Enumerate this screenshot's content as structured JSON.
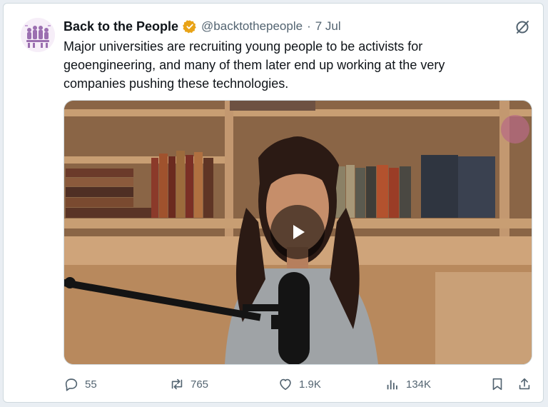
{
  "tweet": {
    "author_name": "Back to the People",
    "handle": "@backtothepeople",
    "separator": "·",
    "date": "7 Jul",
    "text": "Major universities are recruiting young people to be activists for geoengineering, and many of them later end up working at the very companies pushing these technologies."
  },
  "media": {
    "type": "video",
    "play_icon": "play-icon"
  },
  "actions": {
    "replies": "55",
    "reposts": "765",
    "likes": "1.9K",
    "views": "134K"
  },
  "colors": {
    "verified_badge": "#e8a317",
    "secondary_text": "#536471",
    "border": "#cfd9de"
  }
}
